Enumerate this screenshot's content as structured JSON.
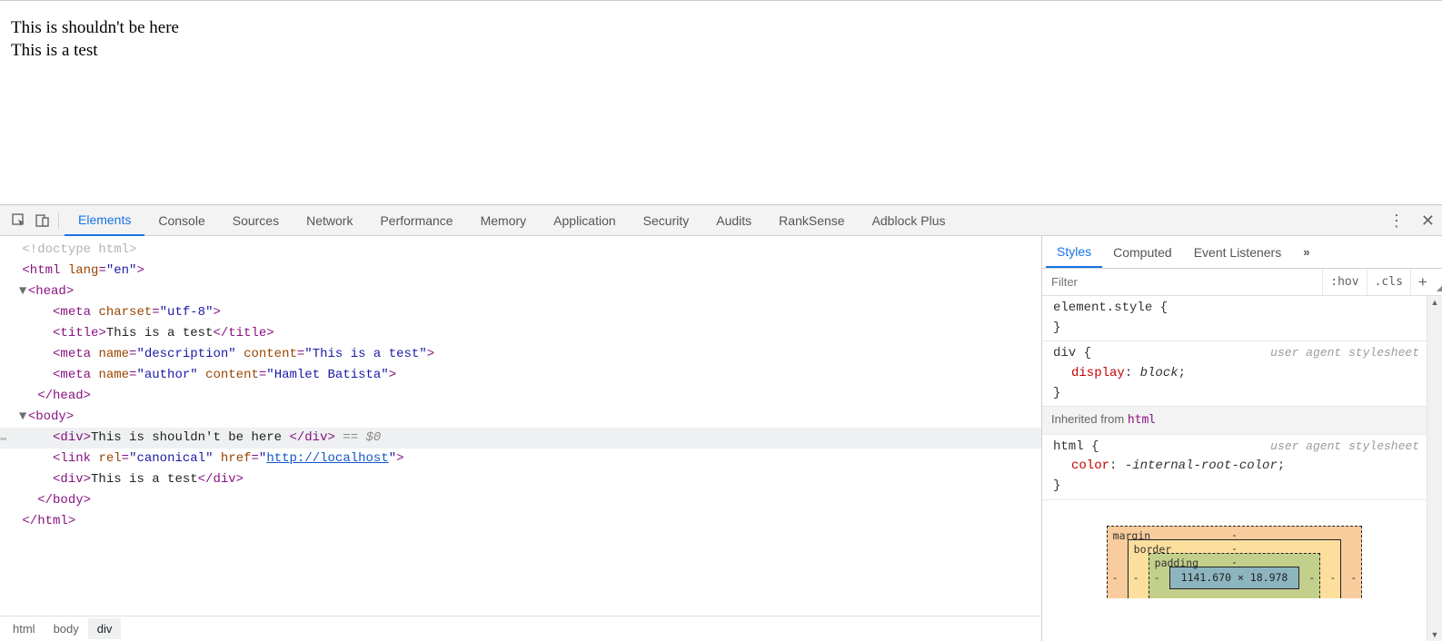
{
  "page": {
    "line1": "This is shouldn't be here",
    "line2": "This is a test"
  },
  "tabs": {
    "items": [
      "Elements",
      "Console",
      "Sources",
      "Network",
      "Performance",
      "Memory",
      "Application",
      "Security",
      "Audits",
      "RankSense",
      "Adblock Plus"
    ],
    "active_index": 0
  },
  "side_tabs": {
    "items": [
      "Styles",
      "Computed",
      "Event Listeners"
    ],
    "active_index": 0,
    "expand": "»"
  },
  "filter": {
    "placeholder": "Filter",
    "hov": ":hov",
    "cls": ".cls",
    "add": "+"
  },
  "dom": {
    "doctype": "<!doctype html>",
    "html_open_1": "<html ",
    "html_lang_name": "lang",
    "html_lang_val": "\"en\"",
    "html_open_2": ">",
    "head_open": "<head>",
    "meta_charset_1": "<meta ",
    "meta_charset_name": "charset",
    "meta_charset_val": "\"utf-8\"",
    "meta_charset_2": ">",
    "title_open": "<title>",
    "title_text": "This is a test",
    "title_close": "</title>",
    "meta_desc_1": "<meta ",
    "meta_desc_name": "name",
    "meta_desc_name_v": "\"description\"",
    "meta_desc_cont": "content",
    "meta_desc_cont_v": "\"This is a test\"",
    "meta_desc_end": ">",
    "meta_auth_1": "<meta ",
    "meta_auth_name": "name",
    "meta_auth_name_v": "\"author\"",
    "meta_auth_cont": "content",
    "meta_auth_cont_v": "\"Hamlet Batista\"",
    "meta_auth_end": ">",
    "head_close": "</head>",
    "body_open": "<body>",
    "sel_div_open": "<div>",
    "sel_div_text": "This is shouldn't be here ",
    "sel_div_close": "</div>",
    "sel_marker": " == $0",
    "link_open": "<link ",
    "link_rel": "rel",
    "link_rel_v": "\"canonical\"",
    "link_href": "href",
    "link_href_q": "\"",
    "link_href_url": "http://localhost",
    "link_end": ">",
    "div2_open": "<div>",
    "div2_text": "This is a test",
    "div2_close": "</div>",
    "body_close": "</body>",
    "html_close": "</html>"
  },
  "breadcrumbs": {
    "items": [
      "html",
      "body",
      "div"
    ],
    "active_index": 2
  },
  "styles": {
    "element_style_sel": "element.style ",
    "brace_open": "{",
    "brace_close": "}",
    "div_sel": "div ",
    "ua_note": "user agent stylesheet",
    "display_prop": "display",
    "display_val": "block",
    "inherit_label": "Inherited from ",
    "inherit_sel": "html",
    "html_sel": "html ",
    "color_prop": "color",
    "color_val": "-internal-root-color"
  },
  "boxmodel": {
    "margin_label": "margin",
    "border_label": "border",
    "padding_label": "padding",
    "content": "1141.670 × 18.978",
    "dash": "-"
  }
}
